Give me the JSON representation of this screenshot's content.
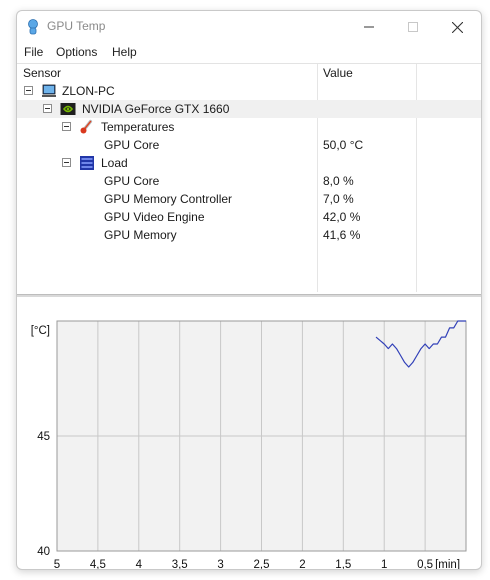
{
  "window": {
    "title": "GPU Temp"
  },
  "menu": [
    "File",
    "Options",
    "Help"
  ],
  "columns": {
    "sensor": "Sensor",
    "value": "Value"
  },
  "tree": [
    {
      "label": "ZLON-PC",
      "value": "",
      "icon": "computer-icon",
      "expander": true
    },
    {
      "label": "NVIDIA GeForce GTX 1660",
      "value": "",
      "icon": "nvidia-icon",
      "expander": true,
      "selected": true
    },
    {
      "label": "Temperatures",
      "value": "",
      "icon": "thermometer-icon",
      "expander": true
    },
    {
      "label": "GPU Core",
      "value": "50,0 °C"
    },
    {
      "label": "Load",
      "value": "",
      "icon": "load-icon",
      "expander": true
    },
    {
      "label": "GPU Core",
      "value": "8,0 %"
    },
    {
      "label": "GPU Memory Controller",
      "value": "7,0 %"
    },
    {
      "label": "GPU Video Engine",
      "value": "42,0 %"
    },
    {
      "label": "GPU Memory",
      "value": "41,6 %"
    }
  ],
  "chart_data": {
    "type": "line",
    "ylabel": "[°C]",
    "xlabel": "[min]",
    "y_ticks": [
      "45",
      "40"
    ],
    "x_ticks": [
      "5",
      "4,5",
      "4",
      "3,5",
      "3",
      "2,5",
      "2",
      "1,5",
      "1",
      "0,5"
    ],
    "xlim": [
      5,
      0
    ],
    "ylim": [
      40,
      50
    ],
    "grid": true,
    "series": [
      {
        "color": "#3140b8",
        "x": [
          1.1,
          1.0,
          0.95,
          0.9,
          0.85,
          0.8,
          0.75,
          0.7,
          0.65,
          0.6,
          0.55,
          0.5,
          0.45,
          0.4,
          0.35,
          0.3,
          0.25,
          0.2,
          0.15,
          0.1,
          0.05,
          0.0
        ],
        "y": [
          49.3,
          49.0,
          48.8,
          49.0,
          48.8,
          48.5,
          48.2,
          48.0,
          48.2,
          48.5,
          48.8,
          49.0,
          48.8,
          49.0,
          49.0,
          49.3,
          49.3,
          49.7,
          49.7,
          50.0,
          50.0,
          50.0
        ]
      }
    ]
  }
}
